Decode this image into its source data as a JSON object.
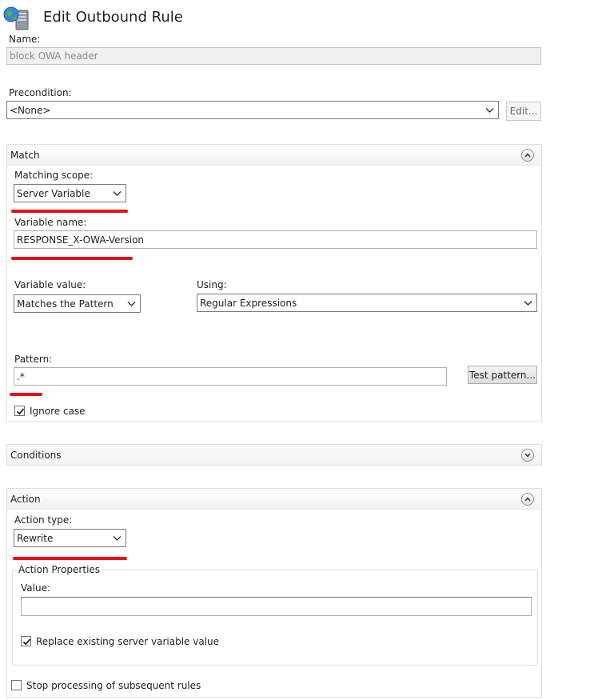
{
  "page": {
    "title": "Edit Outbound Rule",
    "app_icon": "iis-globe-server-icon"
  },
  "name_field": {
    "label": "Name:",
    "value": "block OWA header"
  },
  "precondition": {
    "label": "Precondition:",
    "value": "<None>",
    "edit_button": "Edit..."
  },
  "match": {
    "header": "Match",
    "matching_scope_label": "Matching scope:",
    "matching_scope_value": "Server Variable",
    "variable_name_label": "Variable name:",
    "variable_name_value": "RESPONSE_X-OWA-Version",
    "variable_value_label": "Variable value:",
    "variable_value_value": "Matches the Pattern",
    "using_label": "Using:",
    "using_value": "Regular Expressions",
    "pattern_label": "Pattern:",
    "pattern_value": ".*",
    "test_pattern_button": "Test pattern...",
    "ignore_case_label": "Ignore case",
    "ignore_case_checked": true
  },
  "conditions": {
    "header": "Conditions"
  },
  "action": {
    "header": "Action",
    "action_type_label": "Action type:",
    "action_type_value": "Rewrite",
    "properties_legend": "Action Properties",
    "value_label": "Value:",
    "value_value": "",
    "replace_label": "Replace existing server variable value",
    "replace_checked": true,
    "stop_processing_label": "Stop processing of subsequent rules",
    "stop_processing_checked": false
  },
  "colors": {
    "annotation_underline": "#e3101a",
    "panel_header": "#f1f3f5",
    "border": "#abadb3"
  }
}
